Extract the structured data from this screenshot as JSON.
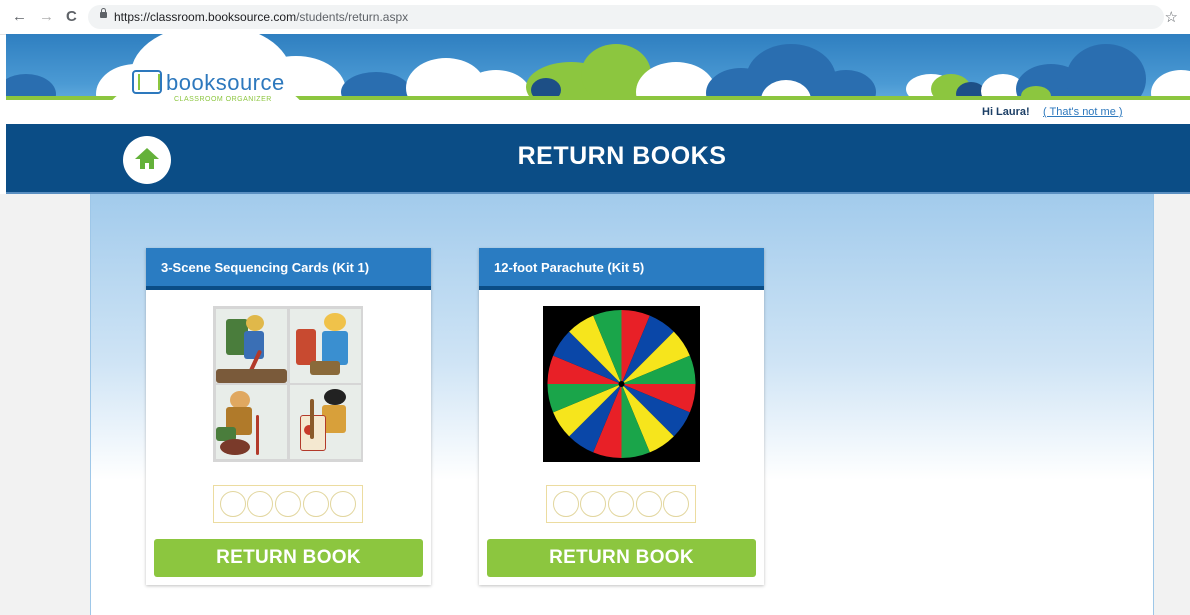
{
  "browser": {
    "nav": {
      "back": "←",
      "forward": "→",
      "reload": "C"
    },
    "url_host": "https://classroom.booksource.com",
    "url_path": "/students/return.aspx",
    "bookmark": "☆"
  },
  "logo": {
    "name": "booksource",
    "tagline": "CLASSROOM ORGANIZER"
  },
  "user": {
    "greeting": "Hi Laura!",
    "not_me_link": "( That's not me )"
  },
  "page": {
    "title": "RETURN BOOKS"
  },
  "cards": [
    {
      "title": "3-Scene Sequencing Cards (Kit 1)",
      "button": "RETURN BOOK",
      "rating": 0
    },
    {
      "title": "12-foot Parachute (Kit 5)",
      "button": "RETURN BOOK",
      "rating": 0
    }
  ],
  "colors": {
    "header_blue": "#0b4d86",
    "card_head_blue": "#2a7cc2",
    "button_green": "#8cc63f",
    "parachute": [
      "#e82027",
      "#0a47a8",
      "#f6e51c",
      "#1aa54a"
    ]
  }
}
